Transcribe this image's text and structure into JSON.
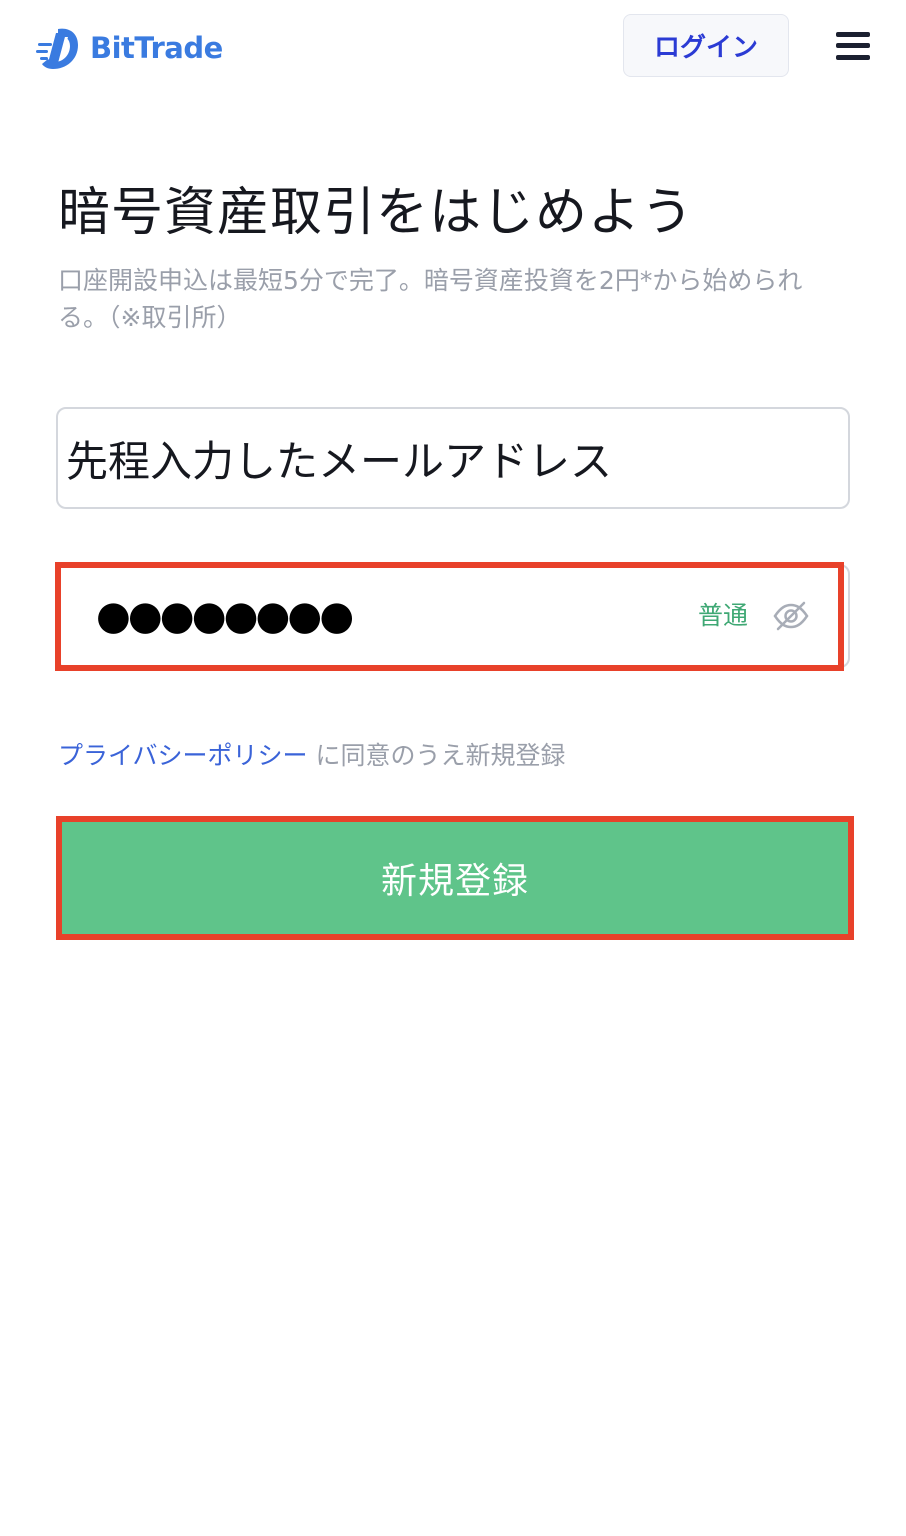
{
  "header": {
    "logo_text": "BitTrade",
    "login_label": "ログイン"
  },
  "main": {
    "title": "暗号資産取引をはじめよう",
    "subtitle": "口座開設申込は最短5分で完了。暗号資産投資を2円*から始められる。（※取引所）",
    "email_value": "先程入力したメールアドレス",
    "password_masked": "●●●●●●●●",
    "password_strength": "普通",
    "privacy_link": "プライバシーポリシー",
    "privacy_text": " に同意のうえ新規登録",
    "register_label": "新規登録"
  },
  "colors": {
    "brand": "#3a7be0",
    "login_text": "#2b3bd4",
    "accent_green": "#5fc48a",
    "strength_green": "#3fa874",
    "highlight_red": "#e8412a",
    "link_blue": "#3a63d8"
  },
  "icons": {
    "logo": "bittrade-logo-icon",
    "menu": "hamburger-menu-icon",
    "eye": "eye-off-icon"
  }
}
